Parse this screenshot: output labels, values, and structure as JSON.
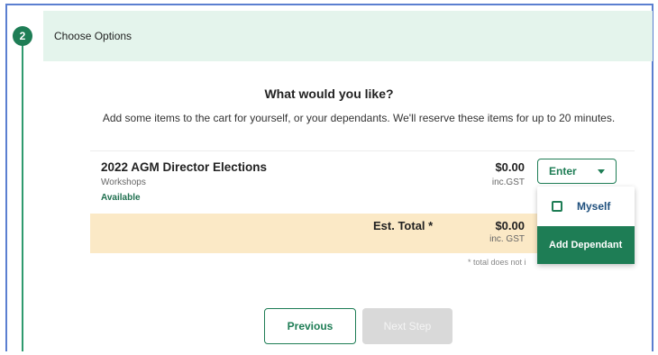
{
  "step": {
    "number": "2",
    "title": "Choose Options"
  },
  "main": {
    "heading": "What would you like?",
    "subtext": "Add some items to the cart for yourself, or your dependants. We'll reserve these items for up to 20 minutes."
  },
  "item": {
    "name": "2022 AGM Director Elections",
    "category": "Workshops",
    "status": "Available",
    "price": "$0.00",
    "gst": "inc.GST"
  },
  "total": {
    "label": "Est. Total *",
    "price": "$0.00",
    "gst": "inc. GST",
    "footnote": "* total does not i"
  },
  "enter_menu": {
    "button_label": "Enter",
    "option_myself": "Myself",
    "option_add_dependant": "Add Dependant"
  },
  "nav": {
    "previous_label": "Previous",
    "next_label": "Next Step"
  },
  "colors": {
    "accent": "#1e7d55",
    "header_bg": "#e4f4ec",
    "total_bg": "#fbe9c6",
    "disabled": "#d9d9d9"
  }
}
